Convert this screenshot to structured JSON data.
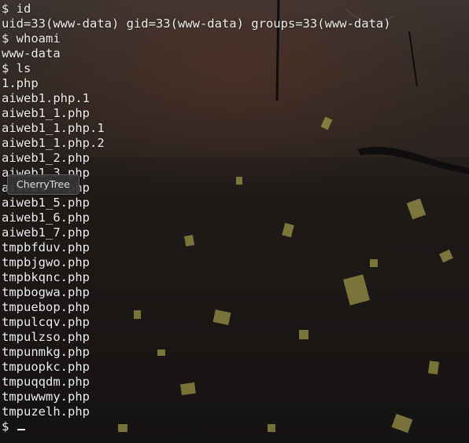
{
  "terminal": {
    "lines": [
      "$ id",
      "uid=33(www-data) gid=33(www-data) groups=33(www-data)",
      "$ whoami",
      "www-data",
      "$ ls",
      "1.php",
      "aiweb1.php.1",
      "aiweb1_1.php",
      "aiweb1_1.php.1",
      "aiweb1_1.php.2",
      "aiweb1_2.php",
      "aiweb1_3.php",
      "aiweb1_4.php",
      "aiweb1_5.php",
      "aiweb1_6.php",
      "aiweb1_7.php",
      "tmpbfduv.php",
      "tmpbjgwo.php",
      "tmpbkqnc.php",
      "tmpbogwa.php",
      "tmpuebop.php",
      "tmpulcqv.php",
      "tmpulzso.php",
      "tmpunmkg.php",
      "tmpuopkc.php",
      "tmpuqqdm.php",
      "tmpuwwmy.php",
      "tmpuzelh.php"
    ],
    "prompt": "$ "
  },
  "tooltip": {
    "text": "CherryTree"
  },
  "colors": {
    "foreground": "#eeeeee",
    "background": "#231a17",
    "wallpaper_accent": "#c9c15a"
  }
}
